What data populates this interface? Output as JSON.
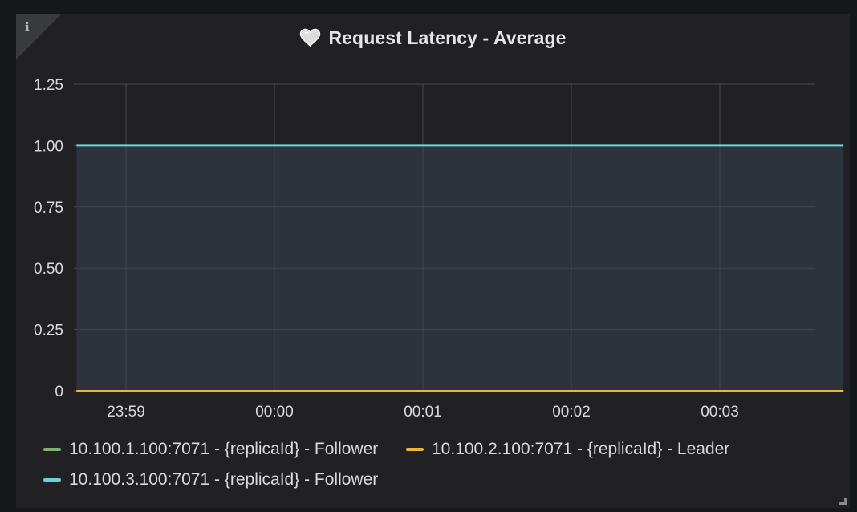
{
  "panel": {
    "title": "Request Latency - Average",
    "info_glyph": "i",
    "title_icon": "heart-icon",
    "info_icon": "info-icon"
  },
  "legend": {
    "items": [
      {
        "label": "10.100.1.100:7071 - {replicaId} - Follower",
        "color": "#7eb26d"
      },
      {
        "label": "10.100.2.100:7071 - {replicaId} - Leader",
        "color": "#eab839"
      },
      {
        "label": "10.100.3.100:7071 - {replicaId} - Follower",
        "color": "#6ed0e0"
      }
    ]
  },
  "chart_data": {
    "type": "area",
    "title": "Request Latency - Average",
    "xlabel": "",
    "ylabel": "",
    "ylim": [
      0,
      1.25
    ],
    "y_ticks": [
      0,
      0.25,
      0.5,
      0.75,
      1.0,
      1.25
    ],
    "y_tick_labels": [
      "0",
      "0.25",
      "0.50",
      "0.75",
      "1.00",
      "1.25"
    ],
    "x_tick_labels": [
      "23:59",
      "00:00",
      "00:01",
      "00:02",
      "00:03"
    ],
    "grid": true,
    "legend_position": "bottom",
    "x": [
      "23:58:40",
      "00:03:50"
    ],
    "series": [
      {
        "name": "10.100.1.100:7071 - {replicaId} - Follower",
        "color": "#7eb26d",
        "values": [
          0,
          0
        ]
      },
      {
        "name": "10.100.2.100:7071 - {replicaId} - Leader",
        "color": "#eab839",
        "values": [
          0,
          0
        ]
      },
      {
        "name": "10.100.3.100:7071 - {replicaId} - Follower",
        "color": "#6ed0e0",
        "values": [
          1,
          1
        ]
      }
    ]
  }
}
